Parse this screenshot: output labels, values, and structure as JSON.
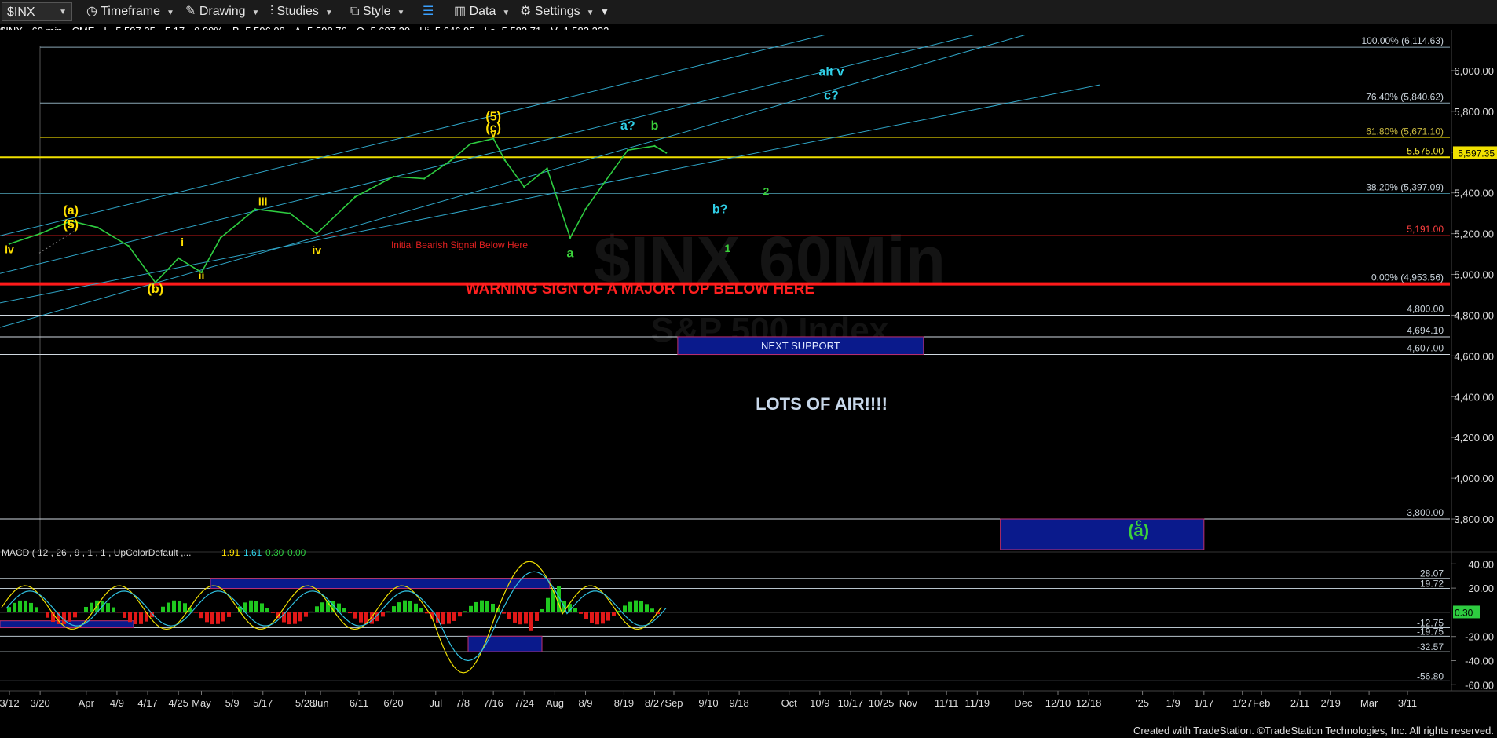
{
  "toolbar": {
    "symbol": "$INX",
    "items": [
      "Timeframe",
      "Drawing",
      "Studies",
      "Style",
      "Data",
      "Settings"
    ]
  },
  "infobar": {
    "name": "$INX - 60 min",
    "exchange": "CME",
    "last": "L=5,597.35",
    "change": "5.17",
    "pct": "0.09%",
    "bid": "B=5,596.08",
    "ask": "A=5,598.76",
    "open": "O=5,607.30",
    "high": "Hi=5,646.95",
    "low": "Lo=5,583.71",
    "volume": "V=1,582,333"
  },
  "colors": {
    "price": "#2ecc40",
    "fib": "#7fa6b8",
    "warning": "#ff2020",
    "yellow": "#ffe000",
    "cyan": "#30d0e8",
    "green_label": "#3bd23b",
    "box": "#0a1a8c"
  },
  "chart_data": [
    {
      "type": "line",
      "title": "",
      "watermark": [
        "$INX 60Min",
        "S&P 500 Index"
      ],
      "ylim": [
        3650,
        6200
      ],
      "y_ticks": [
        "6,000.00",
        "5,800.00",
        "5,600.00",
        "5,400.00",
        "5,200.00",
        "5,000.00",
        "4,800.00",
        "4,600.00",
        "4,400.00",
        "4,200.00",
        "4,000.00",
        "3,800.00"
      ],
      "current_price": "5,597.35",
      "x_ticks": [
        "3/12",
        "3/20",
        "Apr",
        "4/9",
        "4/17",
        "4/25",
        "May",
        "5/9",
        "5/17",
        "5/28",
        "Jun",
        "6/11",
        "6/20",
        "Jul",
        "7/8",
        "7/16",
        "7/24",
        "Aug",
        "8/9",
        "8/19",
        "8/27",
        "Sep",
        "9/10",
        "9/18",
        "Oct",
        "10/9",
        "10/17",
        "10/25",
        "Nov",
        "11/11",
        "11/19",
        "Dec",
        "12/10",
        "12/18",
        "'25",
        "1/9",
        "1/17",
        "1/27",
        "Feb",
        "2/11",
        "2/19",
        "Mar",
        "3/11"
      ],
      "series": [
        {
          "x": [
            "3/12",
            "3/20",
            "3/28",
            "4/4",
            "4/12",
            "4/19",
            "4/25",
            "5/1",
            "5/6",
            "5/15",
            "5/24",
            "5/31",
            "6/10",
            "6/20",
            "6/28",
            "7/5",
            "7/10",
            "7/16",
            "7/19",
            "7/24",
            "7/30",
            "8/5",
            "8/9",
            "8/15",
            "8/20",
            "8/27",
            "8/30"
          ],
          "values": [
            5150,
            5200,
            5262,
            5230,
            5140,
            4960,
            5080,
            5010,
            5180,
            5320,
            5300,
            5200,
            5380,
            5480,
            5470,
            5560,
            5640,
            5666,
            5560,
            5430,
            5520,
            5180,
            5320,
            5480,
            5610,
            5630,
            5597
          ]
        }
      ],
      "levels": [
        {
          "label": "100.00% (6,114.63)",
          "value": 6114.63
        },
        {
          "label": "76.40% (5,840.62)",
          "value": 5840.62
        },
        {
          "label": "61.80% (5,671.10)",
          "value": 5671.1
        },
        {
          "label": "5,575.00",
          "value": 5575.0
        },
        {
          "label": "38.20% (5,397.09)",
          "value": 5397.09
        },
        {
          "label": "5,191.00",
          "value": 5191.0
        },
        {
          "label": "0.00% (4,953.56)",
          "value": 4953.56
        },
        {
          "label": "4,800.00",
          "value": 4800.0
        },
        {
          "label": "4,694.10",
          "value": 4694.1
        },
        {
          "label": "4,607.00",
          "value": 4607.0
        },
        {
          "label": "3,800.00",
          "value": 3800.0
        }
      ],
      "annotations": [
        {
          "text": "(a)",
          "color": "yellow",
          "x": "3/28",
          "y": 5295
        },
        {
          "text": "c",
          "color": "yellow",
          "x": "3/28",
          "y": 5237
        },
        {
          "text": "(5)",
          "color": "yellow",
          "x": "3/28",
          "y": 5225
        },
        {
          "text": "iv",
          "color": "yellow",
          "x": "3/12",
          "y": 5105
        },
        {
          "text": "(b)",
          "color": "yellow",
          "x": "4/19",
          "y": 4910
        },
        {
          "text": "i",
          "color": "yellow",
          "x": "4/26",
          "y": 5140
        },
        {
          "text": "ii",
          "color": "yellow",
          "x": "5/1",
          "y": 4975
        },
        {
          "text": "iii",
          "color": "yellow",
          "x": "5/17",
          "y": 5340
        },
        {
          "text": "iv",
          "color": "yellow",
          "x": "5/31",
          "y": 5100
        },
        {
          "text": "(5)",
          "color": "yellow",
          "x": "7/16",
          "y": 5755
        },
        {
          "text": "(c)",
          "color": "yellow",
          "x": "7/16",
          "y": 5700
        },
        {
          "text": "v",
          "color": "yellow",
          "x": "7/16",
          "y": 5675
        },
        {
          "text": "a",
          "color": "green_label",
          "x": "8/5",
          "y": 5085
        },
        {
          "text": "a?",
          "color": "cyan",
          "x": "8/20",
          "y": 5710
        },
        {
          "text": "b",
          "color": "green_label",
          "x": "8/27",
          "y": 5710
        },
        {
          "text": "b?",
          "color": "cyan",
          "x": "9/13",
          "y": 5300
        },
        {
          "text": "2",
          "color": "green_label",
          "x": "9/25",
          "y": 5390
        },
        {
          "text": "1",
          "color": "green_label",
          "x": "9/15",
          "y": 5110
        },
        {
          "text": "alt v",
          "color": "cyan",
          "x": "10/12",
          "y": 5975
        },
        {
          "text": "c?",
          "color": "cyan",
          "x": "10/12",
          "y": 5860
        },
        {
          "text": "c",
          "color": "green_label",
          "x": "12/31",
          "y": 3765
        },
        {
          "text": "(a)",
          "color": "green_label",
          "x": "12/31",
          "y": 3715
        }
      ],
      "notes": [
        "Initial Bearish Signal Below Here",
        "WARNING SIGN OF A MAJOR TOP BELOW HERE",
        "LOTS OF AIR!!!!"
      ],
      "boxes": [
        {
          "label": "NEXT SUPPORT",
          "from": "9/2",
          "to": "11/5",
          "top": 4694.1,
          "bottom": 4607
        },
        {
          "label": "",
          "from": "11/25",
          "to": "1/17",
          "top": 3800,
          "bottom": 3650
        }
      ]
    },
    {
      "type": "line",
      "title": "MACD ( 12 , 26 , 9 , 1 , 1 , UpColorDefault ,...",
      "values_text": [
        "1.91",
        "1.61",
        "0.30",
        "0.00"
      ],
      "ylim": [
        -65,
        48
      ],
      "y_ticks": [
        "40.00",
        "20.00",
        "-20.00",
        "-40.00",
        "-60.00"
      ],
      "current": "0.30",
      "levels": [
        {
          "label": "28.07",
          "value": 28.07
        },
        {
          "label": "19.72",
          "value": 19.72
        },
        {
          "label": "-12.75",
          "value": -12.75
        },
        {
          "label": "-19.75",
          "value": -19.75
        },
        {
          "label": "-32.57",
          "value": -32.57
        },
        {
          "label": "-56.80",
          "value": -56.8
        }
      ]
    }
  ],
  "footer": "Created with TradeStation. ©TradeStation Technologies, Inc. All rights reserved."
}
